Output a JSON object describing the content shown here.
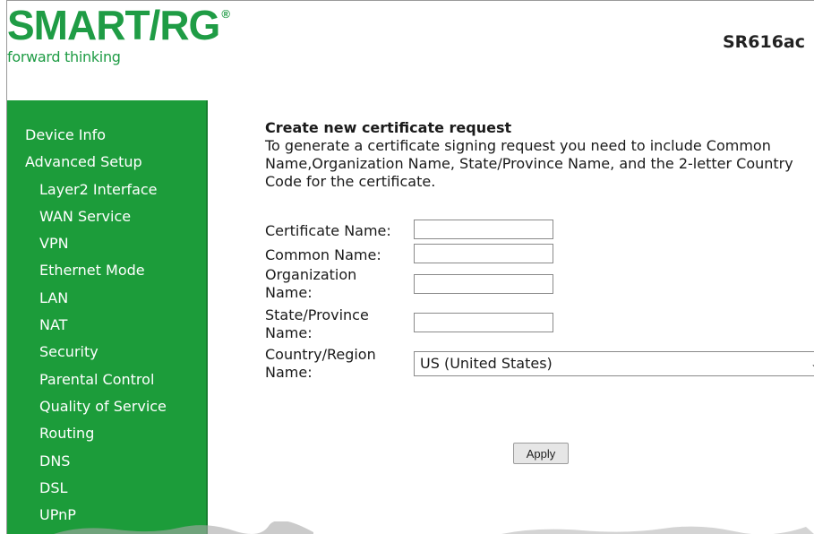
{
  "branding": {
    "logo_text": "SMART/RG",
    "logo_reg": "®",
    "tagline": "forward thinking",
    "model": "SR616ac"
  },
  "sidebar": {
    "items": [
      {
        "label": "Device Info",
        "level": 0
      },
      {
        "label": "Advanced Setup",
        "level": 0
      },
      {
        "label": "Layer2 Interface",
        "level": 1
      },
      {
        "label": "WAN Service",
        "level": 1
      },
      {
        "label": "VPN",
        "level": 1
      },
      {
        "label": "Ethernet Mode",
        "level": 1
      },
      {
        "label": "LAN",
        "level": 1
      },
      {
        "label": "NAT",
        "level": 1
      },
      {
        "label": "Security",
        "level": 1
      },
      {
        "label": "Parental Control",
        "level": 1
      },
      {
        "label": "Quality of Service",
        "level": 1
      },
      {
        "label": "Routing",
        "level": 1
      },
      {
        "label": "DNS",
        "level": 1
      },
      {
        "label": "DSL",
        "level": 1
      },
      {
        "label": "UPnP",
        "level": 1
      }
    ]
  },
  "form": {
    "title": "Create new certificate request",
    "description": "To generate a certificate signing request you need to include Common Name,Organization Name, State/Province Name, and the 2-letter Country Code for the certificate.",
    "fields": {
      "certificate_name": {
        "label": "Certificate Name:",
        "value": ""
      },
      "common_name": {
        "label": "Common Name:",
        "value": ""
      },
      "organization_name": {
        "label": "Organization Name:",
        "value": ""
      },
      "state_name": {
        "label": "State/Province Name:",
        "value": ""
      },
      "country_name": {
        "label": "Country/Region Name:",
        "value": "US (United States)"
      }
    },
    "apply_label": "Apply"
  },
  "icons": {
    "dropdown": "chevron-down-icon"
  },
  "colors": {
    "brand_green": "#1f9c45",
    "sidebar_green": "#1c9c3a"
  }
}
